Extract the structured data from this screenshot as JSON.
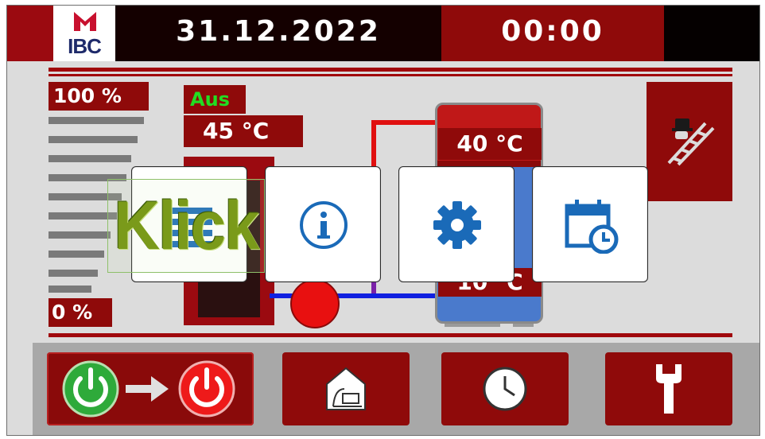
{
  "header": {
    "logo_text": "IBC",
    "date": "31.12.2022",
    "time": "00:00"
  },
  "level_gauge": {
    "top_label": "100 %",
    "bottom_label": "0 %"
  },
  "boiler": {
    "status": "Aus",
    "temperature": "45 °C"
  },
  "tank": {
    "top_temperature": "40 °C",
    "bottom_temperature": "10 °C"
  },
  "overlay": {
    "klick_label": "Klick",
    "menu_tiles": [
      "list-icon",
      "info-icon",
      "gear-icon",
      "calendar-clock-icon"
    ]
  },
  "bottom_nav": [
    "power-switch-icon",
    "house-heating-icon",
    "clock-icon",
    "wrench-icon"
  ],
  "colors": {
    "accent_red": "#8f0a0a",
    "status_green": "#22dd22",
    "icon_blue": "#1a6ab8"
  }
}
